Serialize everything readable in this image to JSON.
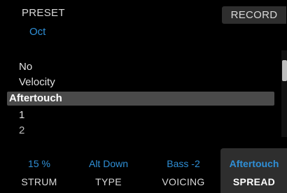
{
  "header": {
    "preset_label": "PRESET",
    "preset_value": "Oct",
    "record_label": "RECORD"
  },
  "list": {
    "items": [
      {
        "label": "No"
      },
      {
        "label": "Velocity"
      },
      {
        "label": "Aftertouch"
      },
      {
        "label": "1"
      },
      {
        "label": "2"
      }
    ],
    "selected_index": 2
  },
  "params": [
    {
      "label": "STRUM",
      "value": "15 %"
    },
    {
      "label": "TYPE",
      "value": "Alt Down"
    },
    {
      "label": "VOICING",
      "value": "Bass -2"
    },
    {
      "label": "SPREAD",
      "value": "Aftertouch"
    }
  ],
  "active_param_index": 3,
  "colors": {
    "accent": "#2f8fd6",
    "background": "#000000",
    "panel": "#2e2e2e",
    "selection": "#4a4a4a"
  }
}
